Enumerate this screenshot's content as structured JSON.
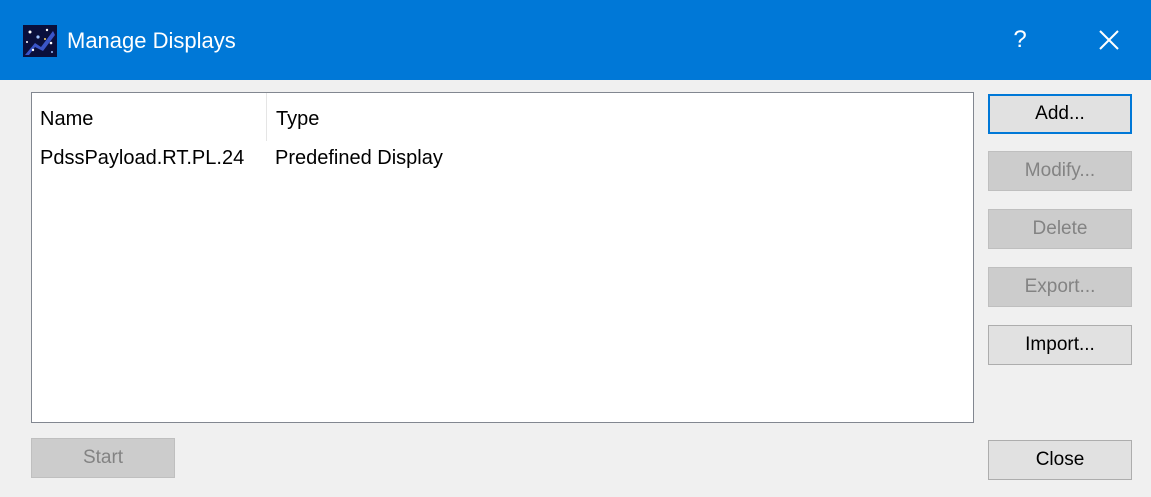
{
  "window": {
    "title": "Manage Displays",
    "help_label": "?",
    "app_icon": "starfield-app-icon",
    "close_icon": "close-icon"
  },
  "list": {
    "columns": [
      "Name",
      "Type"
    ],
    "rows": [
      {
        "name": "PdssPayload.RT.PL.24",
        "type": "Predefined Display"
      }
    ]
  },
  "buttons": {
    "add": "Add...",
    "modify": "Modify...",
    "delete": "Delete",
    "export": "Export...",
    "import": "Import...",
    "start": "Start",
    "close": "Close"
  },
  "colors": {
    "titlebar": "#0078d7",
    "disabled_text": "#838383"
  }
}
